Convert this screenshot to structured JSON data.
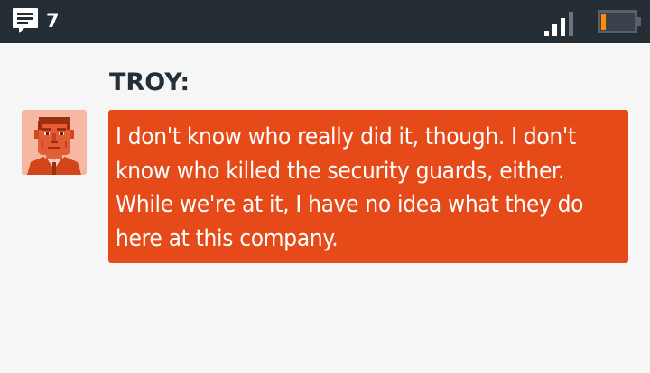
{
  "status_bar": {
    "message_icon": "chat-bubble-icon",
    "message_count": "7",
    "signal_icon": "signal-strength-icon",
    "battery_icon": "battery-low-icon",
    "battery_level": 0.2,
    "colors": {
      "bar_background": "#252e35",
      "battery_fill": "#ff8c00"
    }
  },
  "dialogue": {
    "speaker": "TROY:",
    "avatar_icon": "troy-portrait-icon",
    "message": "I don't know who really did it, though. I don't know who killed the security guards, either. While we're at it, I have no idea what they do here at this company.",
    "colors": {
      "bubble": "#e64a19",
      "speaker_text": "#243038",
      "background": "#f6f6f6"
    }
  }
}
